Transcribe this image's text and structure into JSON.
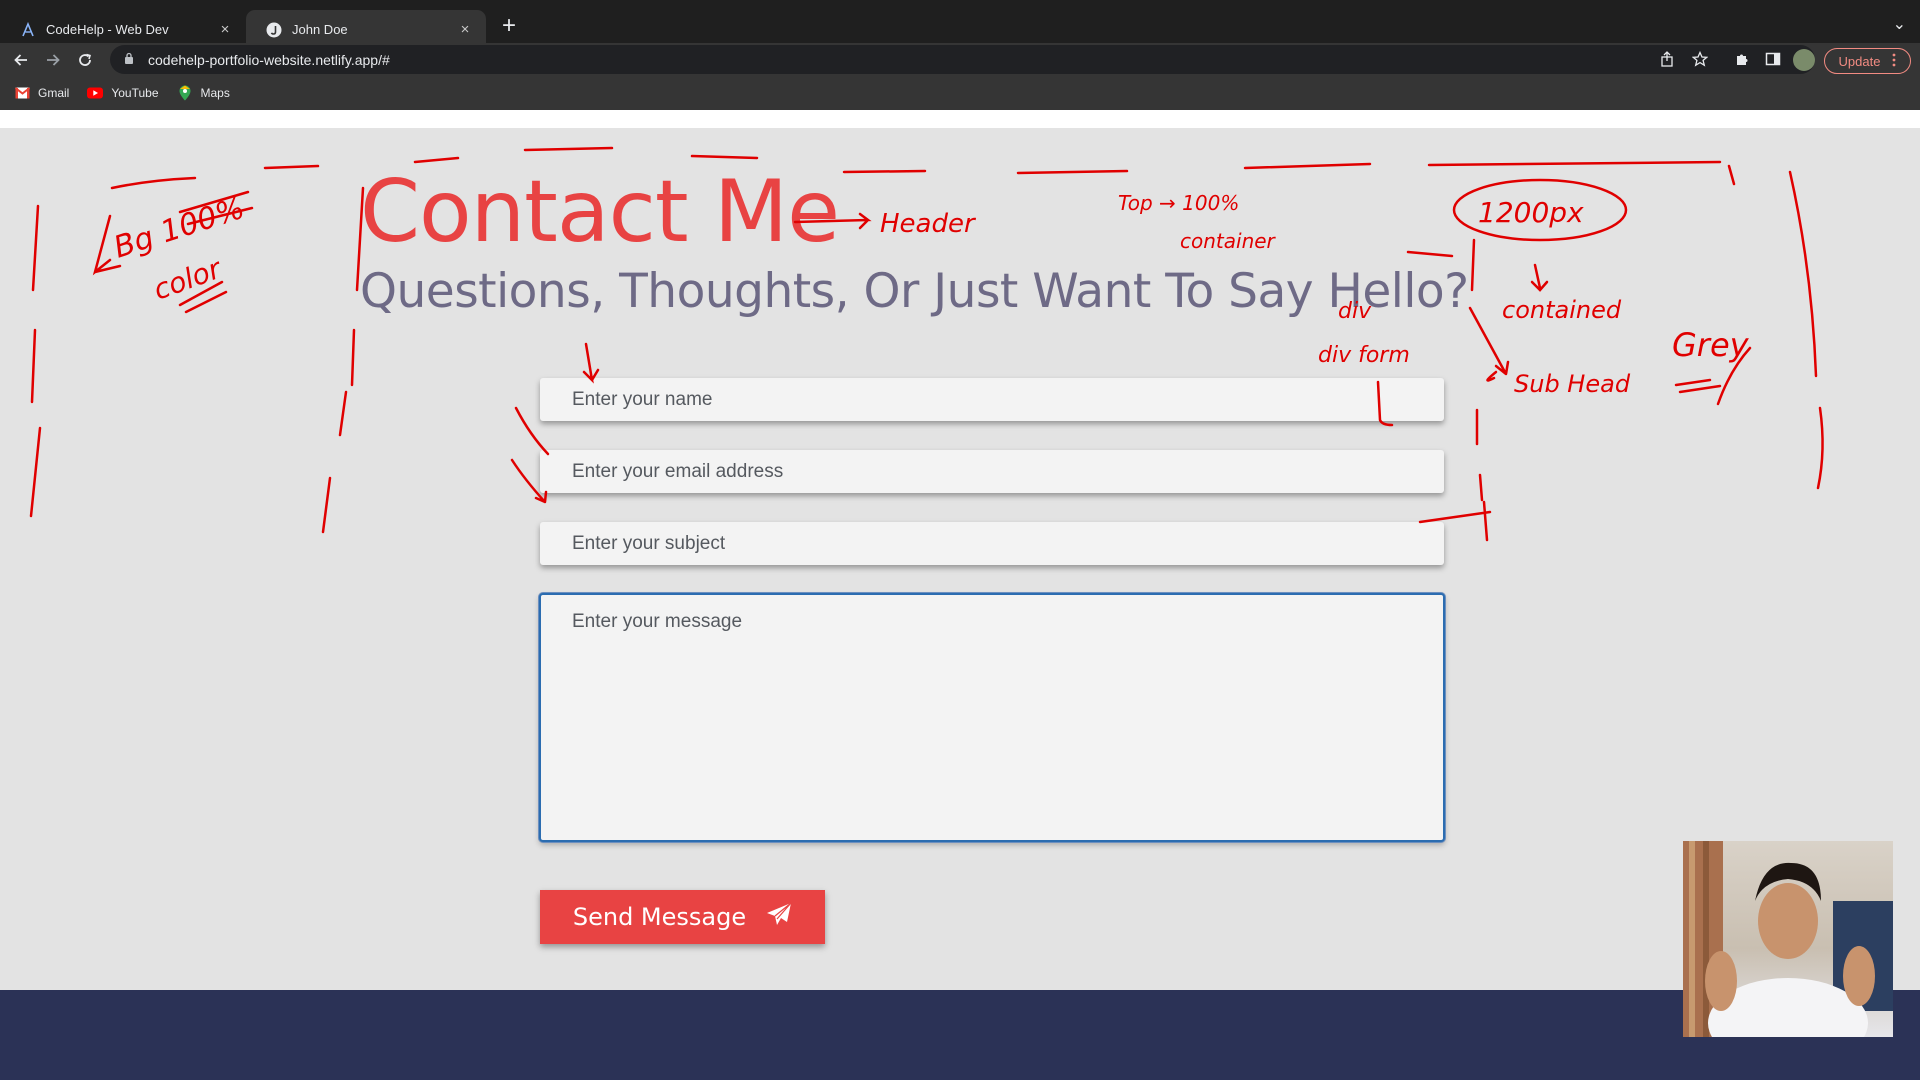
{
  "browser": {
    "tabs": [
      {
        "title": "CodeHelp - Web Dev",
        "close": "×"
      },
      {
        "title": "John Doe",
        "close": "×"
      }
    ],
    "new_tab": "+",
    "tab_menu": "⌄",
    "url": "codehelp-portfolio-website.netlify.app/#",
    "update_label": "Update",
    "bookmarks": [
      {
        "label": "Gmail",
        "icon": "gmail-icon"
      },
      {
        "label": "YouTube",
        "icon": "youtube-icon"
      },
      {
        "label": "Maps",
        "icon": "maps-icon"
      }
    ]
  },
  "contact": {
    "heading": "Contact Me",
    "subheading": "Questions, Thoughts, Or Just Want To Say Hello?",
    "name_placeholder": "Enter your name",
    "email_placeholder": "Enter your email address",
    "subject_placeholder": "Enter your subject",
    "message_placeholder": "Enter your message",
    "send_label": "Send Message"
  },
  "annotations": {
    "bg_note_1": "Bg 100%",
    "bg_note_2": "color",
    "header_note": "Header",
    "top_note": "Top → 100%",
    "container_note": "container",
    "div_note": "div",
    "div_form_note": "div form",
    "width_note": "1200px",
    "contained_note": "contained",
    "grey_note": "Grey",
    "subhead_note": "Sub Head"
  },
  "colors": {
    "accent": "#e84343",
    "subheading": "#6e6a86",
    "page_bg": "#e3e3e3",
    "footer": "#2b3256",
    "annotation": "#e00000"
  }
}
